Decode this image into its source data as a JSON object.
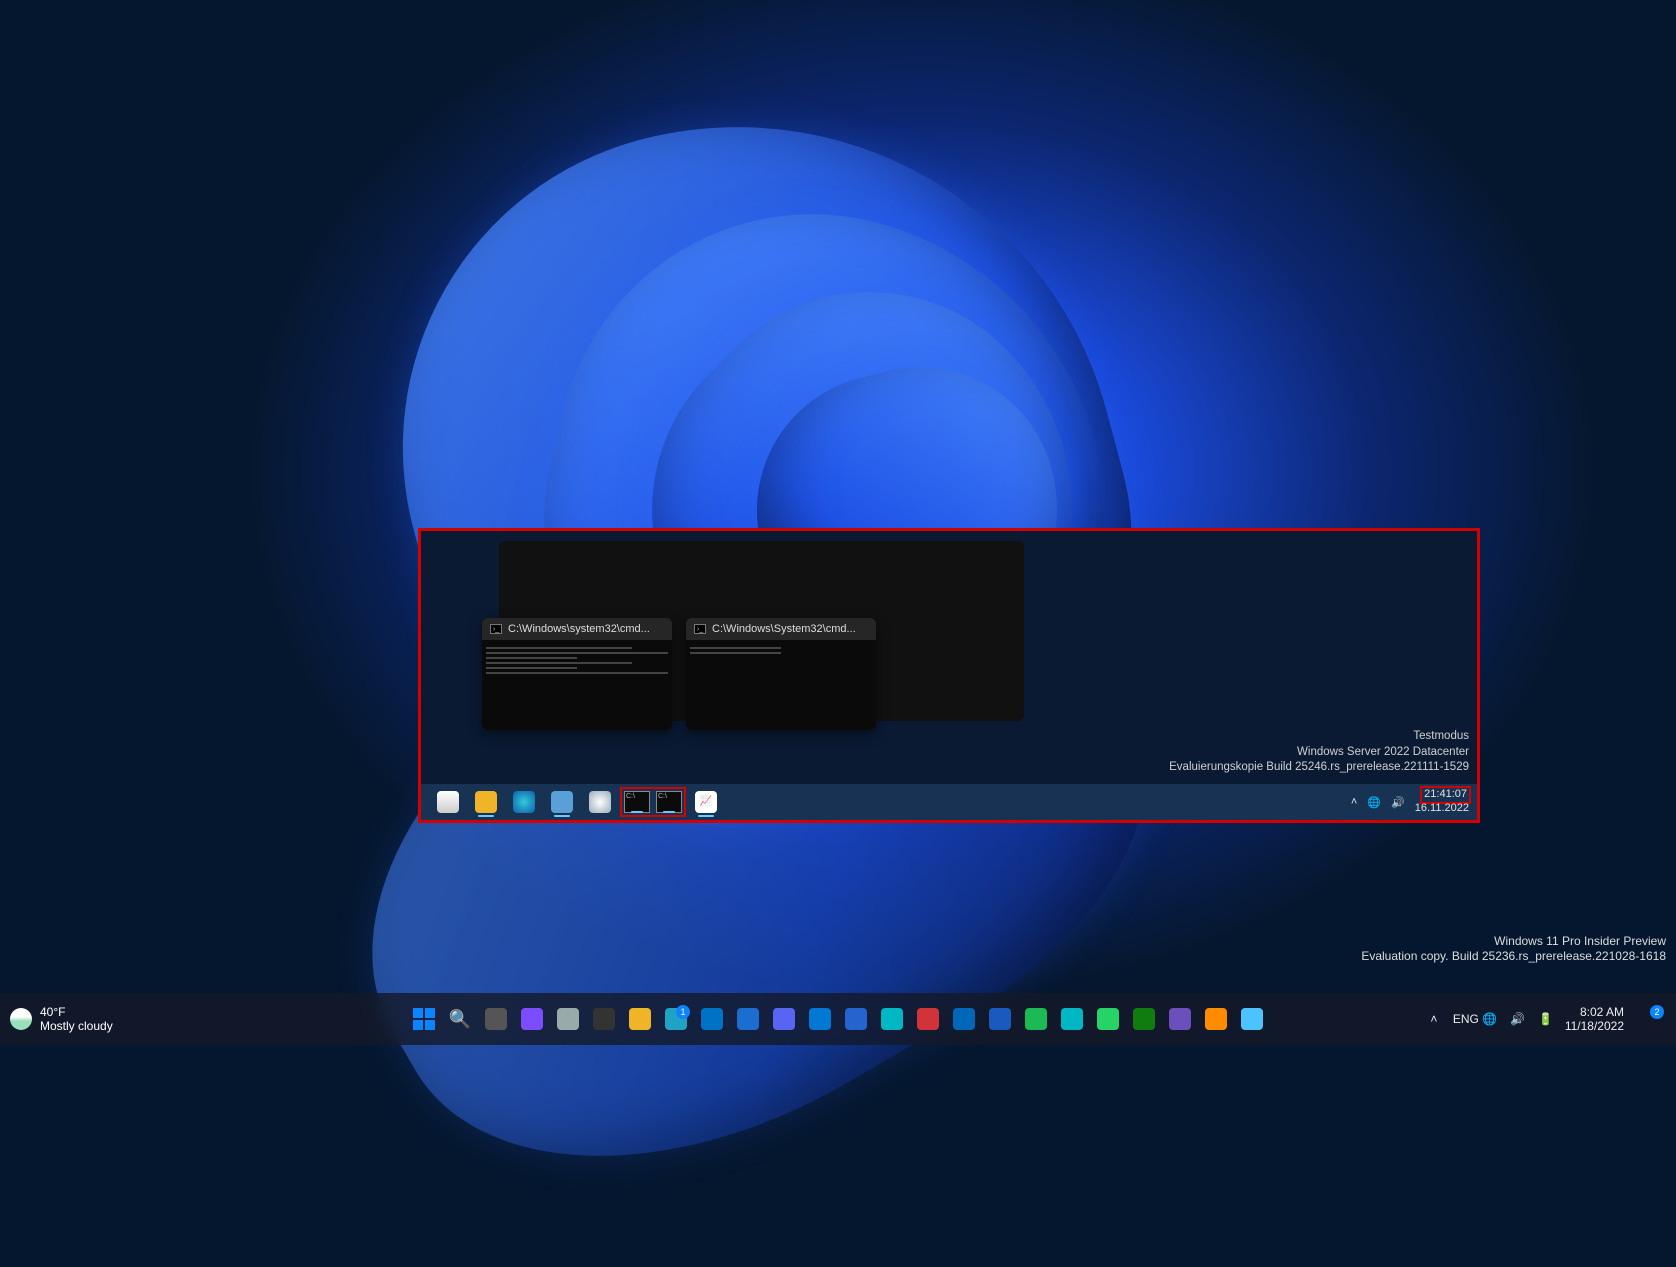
{
  "weather": {
    "temp": "40°F",
    "cond": "Mostly cloudy"
  },
  "outer_watermark": {
    "line1": "Windows 11 Pro Insider Preview",
    "line2": "Evaluation copy. Build 25236.rs_prerelease.221028-1618"
  },
  "systray": {
    "lang": "ENG",
    "time": "8:02 AM",
    "date": "11/18/2022",
    "notif_count": "2"
  },
  "taskbar_apps": [
    "start",
    "search",
    "task-view",
    "chat",
    "settings",
    "terminal",
    "file-explorer",
    "edge",
    "outlook",
    "store",
    "discord",
    "calendar",
    "todo",
    "photos",
    "powertoys",
    "vscode",
    "word",
    "spotify",
    "cortana",
    "whatsapp",
    "xbox",
    "more-1",
    "more-2",
    "more-3"
  ],
  "inner": {
    "thumbs": [
      {
        "title": "C:\\Windows\\system32\\cmd..."
      },
      {
        "title": "C:\\Windows\\System32\\cmd..."
      }
    ],
    "watermark": {
      "line1": "Testmodus",
      "line2": "Windows Server 2022 Datacenter",
      "line3": "Evaluierungskopie Build 25246.rs_prerelease.221111-1529"
    },
    "clock": {
      "time": "21:41:07",
      "date": "16.11.2022"
    },
    "tb_icons": [
      "task-view",
      "file-explorer",
      "edge",
      "server-manager",
      "disc",
      "cmd-group",
      "chart"
    ]
  },
  "app_colors": {
    "start": "#0a84ff",
    "search": "#ddd",
    "task-view": "#555",
    "chat": "#7c4dff",
    "settings": "#9aa",
    "terminal": "#333",
    "file-explorer": "#f0b429",
    "edge": "#1fa2c4",
    "outlook": "#0072c6",
    "store": "#1c6dd0",
    "discord": "#5865f2",
    "calendar": "#0078d4",
    "todo": "#2564cf",
    "photos": "#00b7c3",
    "powertoys": "#d13438",
    "vscode": "#0066b8",
    "word": "#185abd",
    "spotify": "#1db954",
    "cortana": "#00b7c3",
    "whatsapp": "#25d366",
    "xbox": "#107c10",
    "more-1": "#6b4fbb",
    "more-2": "#ff8c00",
    "more-3": "#4cc2ff"
  }
}
